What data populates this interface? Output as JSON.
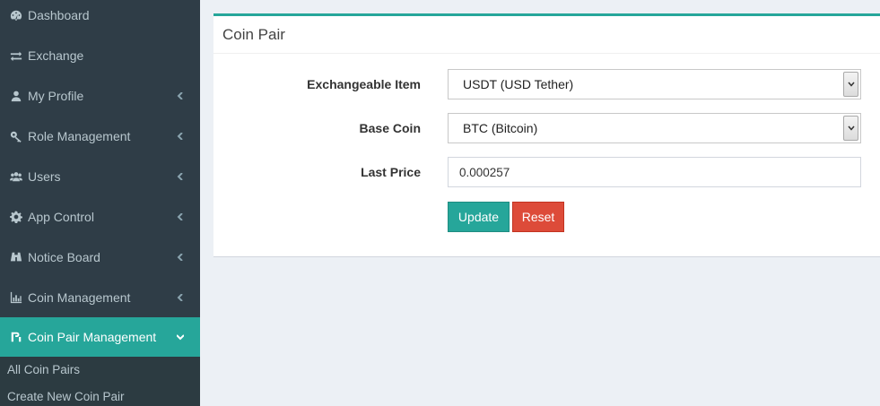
{
  "sidebar": {
    "items": [
      {
        "label": "Dashboard",
        "icon": "dashboard-icon",
        "has_chevron": false
      },
      {
        "label": "Exchange",
        "icon": "exchange-icon",
        "has_chevron": false
      },
      {
        "label": "My Profile",
        "icon": "user-icon",
        "has_chevron": true
      },
      {
        "label": "Role Management",
        "icon": "key-icon",
        "has_chevron": true
      },
      {
        "label": "Users",
        "icon": "users-icon",
        "has_chevron": true
      },
      {
        "label": "App Control",
        "icon": "gear-icon",
        "has_chevron": true
      },
      {
        "label": "Notice Board",
        "icon": "binoculars-icon",
        "has_chevron": true
      },
      {
        "label": "Coin Management",
        "icon": "bar-chart-icon",
        "has_chevron": true
      },
      {
        "label": "Coin Pair Management",
        "icon": "coin-pair-icon",
        "has_chevron": true,
        "active": true
      }
    ],
    "submenu": [
      {
        "label": "All Coin Pairs"
      },
      {
        "label": "Create New Coin Pair"
      }
    ]
  },
  "panel": {
    "title": "Coin Pair",
    "fields": {
      "exchangeable_item": {
        "label": "Exchangeable Item",
        "value": "USDT (USD Tether)"
      },
      "base_coin": {
        "label": "Base Coin",
        "value": "BTC (Bitcoin)"
      },
      "last_price": {
        "label": "Last Price",
        "value": "0.000257"
      }
    },
    "buttons": {
      "update": "Update",
      "reset": "Reset"
    }
  },
  "colors": {
    "accent": "#26a69a",
    "danger": "#dd4b39",
    "sidebar_bg": "#2f3d47",
    "page_bg": "#ecf0f5"
  }
}
